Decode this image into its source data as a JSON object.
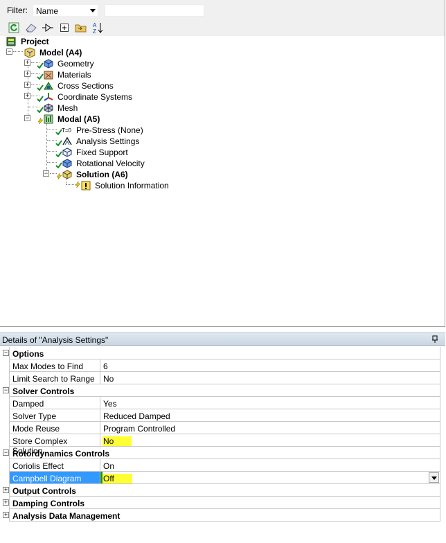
{
  "filter": {
    "label": "Filter:",
    "selected": "Name",
    "text_value": ""
  },
  "toolbar": {
    "icons": [
      "refresh-icon",
      "eraser-icon",
      "suppress-icon",
      "expand-all-icon",
      "folder-icon",
      "sort-az-icon"
    ],
    "sort_glyph": "A Z"
  },
  "tree": {
    "project": "Project",
    "model": "Model (A4)",
    "geometry": "Geometry",
    "materials": "Materials",
    "cross_sections": "Cross Sections",
    "coordinate_systems": "Coordinate Systems",
    "mesh": "Mesh",
    "modal": "Modal (A5)",
    "pre_stress": "Pre-Stress (None)",
    "analysis_settings": "Analysis Settings",
    "fixed_support": "Fixed Support",
    "rotational_velocity": "Rotational Velocity",
    "solution": "Solution (A6)",
    "solution_information": "Solution Information",
    "prestress_glyph": "T=0"
  },
  "details": {
    "title": "Details of \"Analysis Settings\"",
    "rows": [
      {
        "kind": "category",
        "label": "Options",
        "expander": "−"
      },
      {
        "kind": "prop",
        "key": "Max Modes to Find",
        "value": "6"
      },
      {
        "kind": "prop",
        "key": "Limit Search to Range",
        "value": "No"
      },
      {
        "kind": "category",
        "label": "Solver Controls",
        "expander": "−"
      },
      {
        "kind": "prop",
        "key": "Damped",
        "value": "Yes"
      },
      {
        "kind": "prop",
        "key": "Solver Type",
        "value": "Reduced Damped"
      },
      {
        "kind": "prop",
        "key": "Mode Reuse",
        "value": "Program Controlled"
      },
      {
        "kind": "prop",
        "key": "Store Complex Solution",
        "value": "No",
        "highlight": true
      },
      {
        "kind": "category",
        "label": "Rotordynamics Controls",
        "expander": "−"
      },
      {
        "kind": "prop",
        "key": "Coriolis Effect",
        "value": "On"
      },
      {
        "kind": "prop",
        "key": "Campbell Diagram",
        "value": "Off",
        "highlight": true,
        "selected": true
      },
      {
        "kind": "category",
        "label": "Output Controls",
        "expander": "+"
      },
      {
        "kind": "category",
        "label": "Damping Controls",
        "expander": "+"
      },
      {
        "kind": "category",
        "label": "Analysis Data Management",
        "expander": "+"
      }
    ]
  },
  "colors": {
    "selection": "#3399ff",
    "highlight": "#ffff33",
    "check": "#1e8c2d",
    "lightning": "#e8c400"
  }
}
